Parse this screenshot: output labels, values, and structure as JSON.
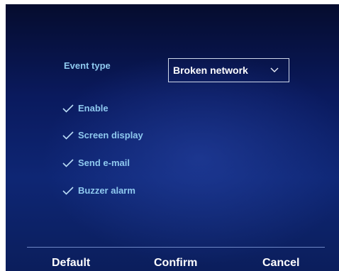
{
  "event": {
    "label": "Event type",
    "selected": "Broken network"
  },
  "options": {
    "enable": {
      "label": "Enable",
      "checked": true
    },
    "screen_display": {
      "label": "Screen display",
      "checked": true
    },
    "send_email": {
      "label": "Send e-mail",
      "checked": true
    },
    "buzzer_alarm": {
      "label": "Buzzer alarm",
      "checked": true
    }
  },
  "footer": {
    "default_label": "Default",
    "confirm_label": "Confirm",
    "cancel_label": "Cancel"
  },
  "colors": {
    "background": "#0b1e5c",
    "label_text": "#8fc9ef",
    "value_text": "#ffffff"
  },
  "icons": {
    "check": "check-icon",
    "dropdown": "chevron-down-icon"
  }
}
